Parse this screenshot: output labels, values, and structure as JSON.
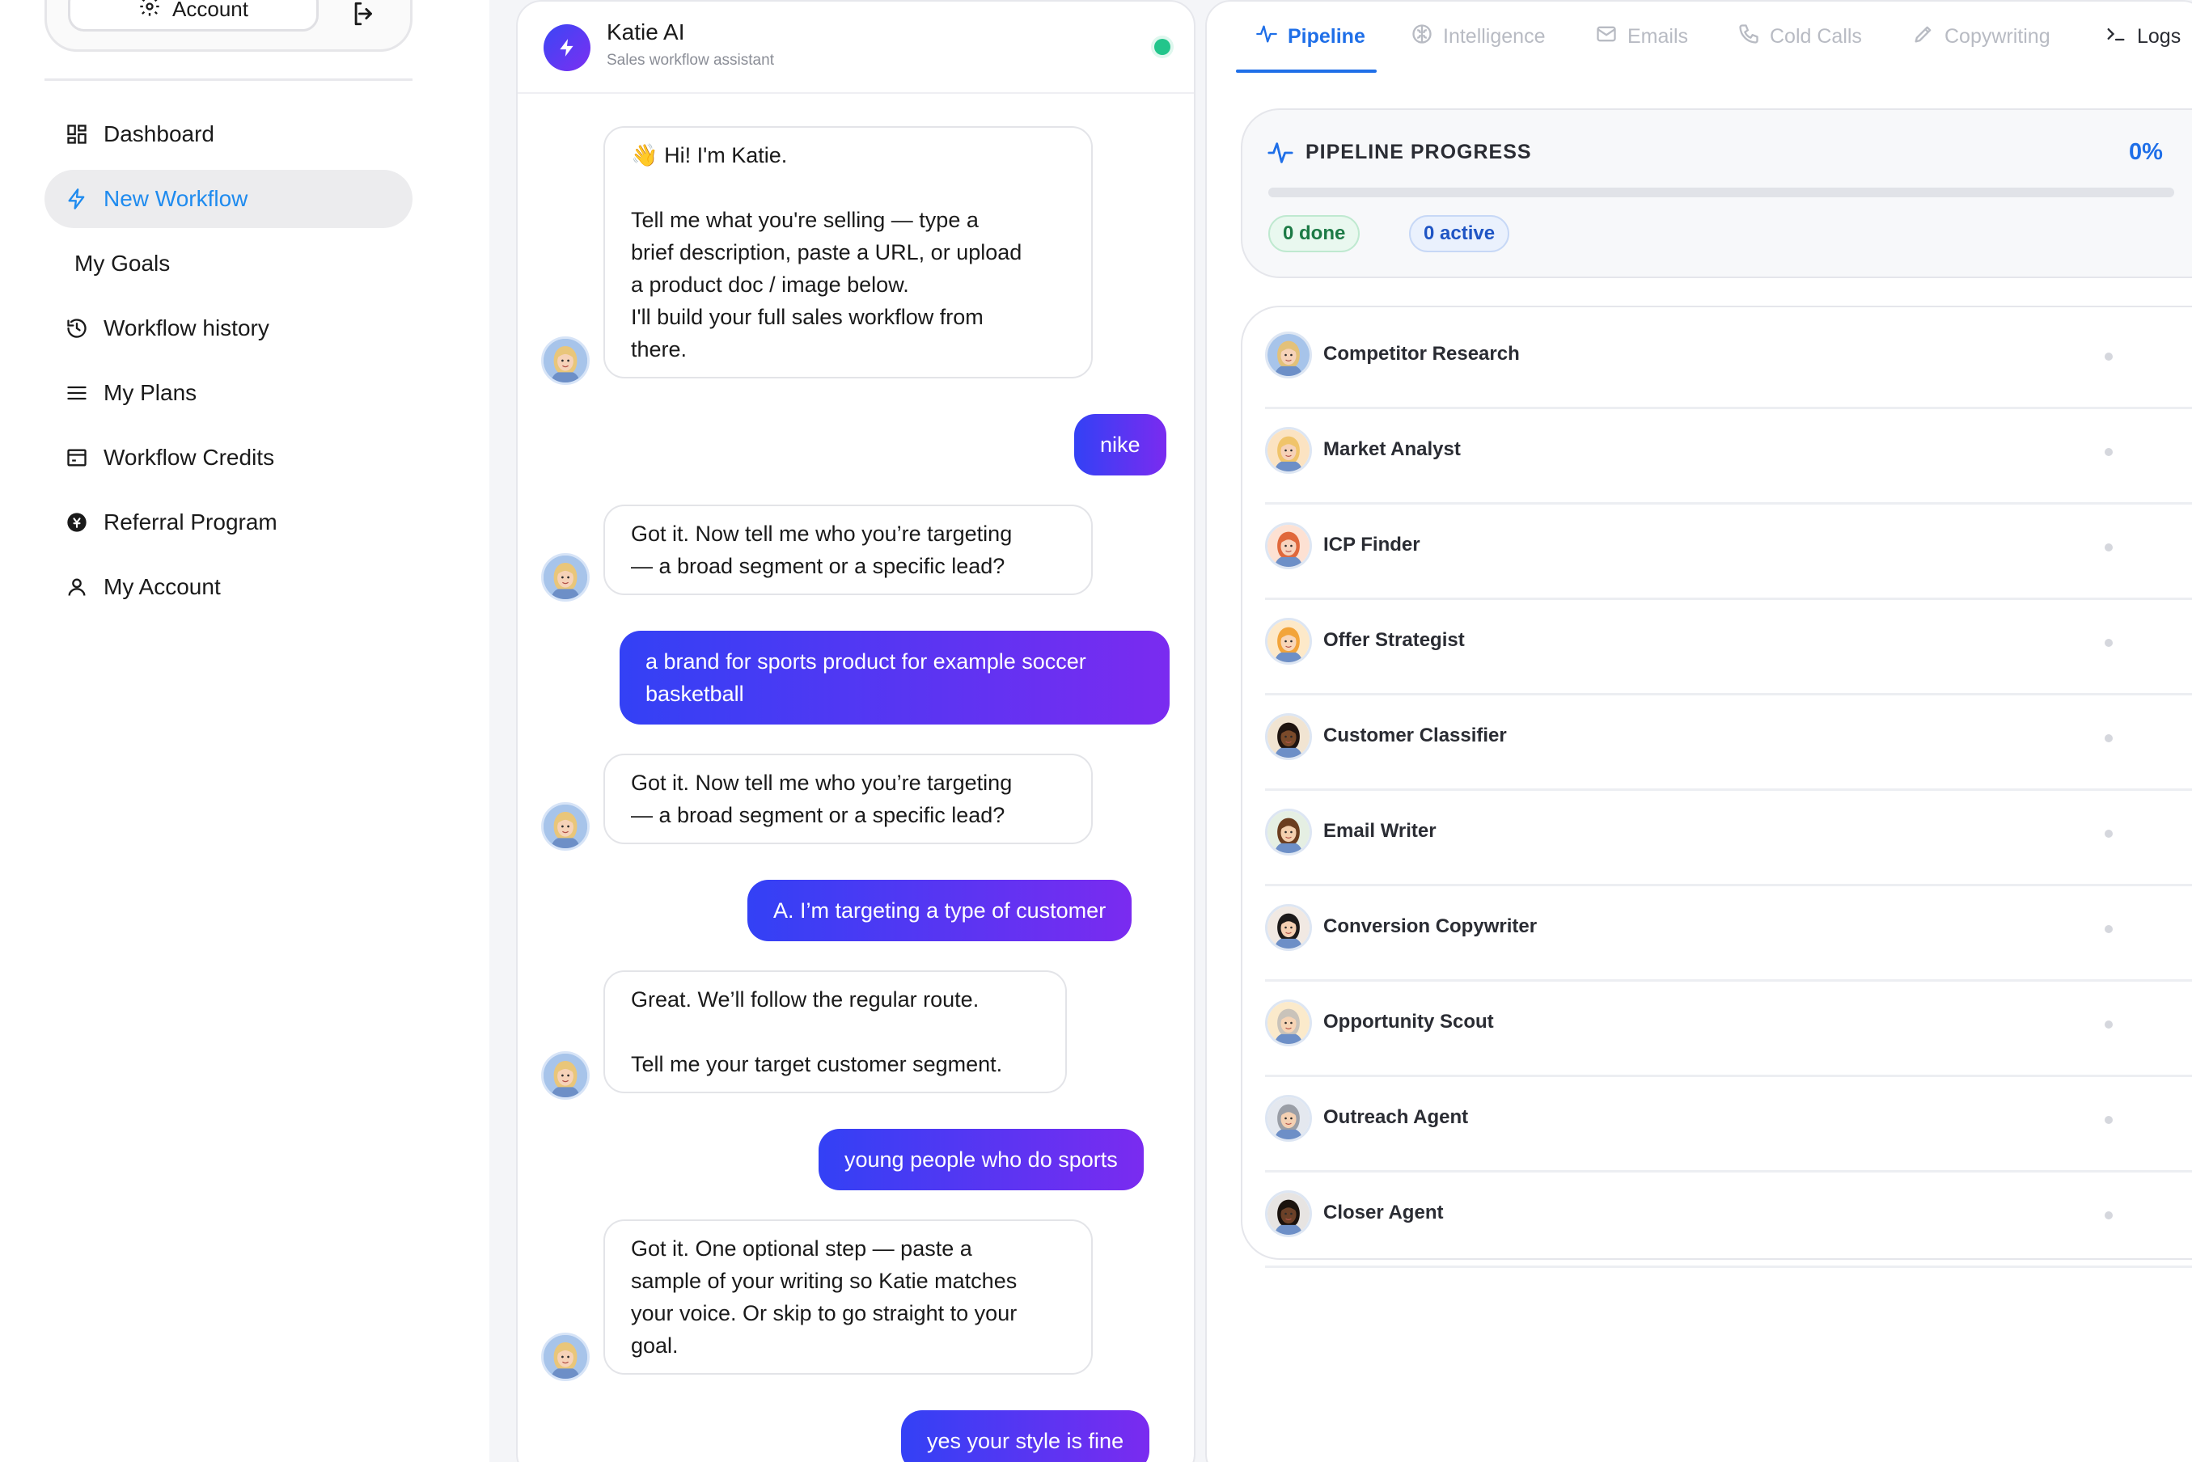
{
  "sidebar": {
    "account_label": "Account",
    "items": [
      {
        "label": "Dashboard",
        "icon": "dashboard-icon",
        "active": false
      },
      {
        "label": "New Workflow",
        "icon": "bolt-icon",
        "active": true
      },
      {
        "label": "My Goals",
        "icon": "",
        "active": false
      },
      {
        "label": "Workflow history",
        "icon": "history-icon",
        "active": false
      },
      {
        "label": "My Plans",
        "icon": "list-icon",
        "active": false
      },
      {
        "label": "Workflow Credits",
        "icon": "credits-icon",
        "active": false
      },
      {
        "label": "Referral Program",
        "icon": "coin-icon",
        "active": false
      },
      {
        "label": "My Account",
        "icon": "user-icon",
        "active": false
      }
    ]
  },
  "chat": {
    "title": "Katie AI",
    "subtitle": "Sales workflow assistant",
    "status": "online",
    "messages": [
      {
        "role": "bot",
        "text": "👋 Hi! I'm Katie.\n\nTell me what you're selling — type a\nbrief description, paste a URL, or upload\na product doc / image below.\nI'll build your full sales workflow from\nthere."
      },
      {
        "role": "user",
        "text": "nike"
      },
      {
        "role": "bot",
        "text": "Got it. Now tell me who you’re targeting\n— a broad segment or a specific lead?"
      },
      {
        "role": "user",
        "text": "a brand for sports product for example soccer\nbasketball"
      },
      {
        "role": "bot",
        "text": "Got it. Now tell me who you’re targeting\n— a broad segment or a specific lead?"
      },
      {
        "role": "user",
        "text": "A. I’m targeting a type of customer"
      },
      {
        "role": "bot",
        "text": "Great. We’ll follow the regular route.\n\nTell me your target customer segment."
      },
      {
        "role": "user",
        "text": "young people who do sports"
      },
      {
        "role": "bot",
        "text": "Got it. One optional step — paste a\nsample of your writing so Katie matches\nyour voice. Or skip to go straight to your\ngoal."
      },
      {
        "role": "user",
        "text": "yes your style is fine"
      }
    ]
  },
  "tabs": [
    {
      "label": "Pipeline",
      "icon": "pulse-icon",
      "active": true
    },
    {
      "label": "Intelligence",
      "icon": "brain-icon",
      "active": false
    },
    {
      "label": "Emails",
      "icon": "mail-icon",
      "active": false
    },
    {
      "label": "Cold Calls",
      "icon": "phone-icon",
      "active": false
    },
    {
      "label": "Copywriting",
      "icon": "pen-icon",
      "active": false
    },
    {
      "label": "Logs",
      "icon": "terminal-icon",
      "active": false
    }
  ],
  "pipeline": {
    "title": "PIPELINE PROGRESS",
    "percent_label": "0%",
    "progress": 0,
    "done_label": "0 done",
    "active_label": "0 active",
    "agents": [
      {
        "name": "Competitor Research",
        "avatar": "woman-blonde-avatar"
      },
      {
        "name": "Market Analyst",
        "avatar": "man-blond-avatar"
      },
      {
        "name": "ICP Finder",
        "avatar": "woman-redhead-avatar"
      },
      {
        "name": "Offer Strategist",
        "avatar": "woman-orange-avatar"
      },
      {
        "name": "Customer Classifier",
        "avatar": "man-dark-avatar"
      },
      {
        "name": "Email Writer",
        "avatar": "man-brown-avatar"
      },
      {
        "name": "Conversion Copywriter",
        "avatar": "woman-black-hair-avatar"
      },
      {
        "name": "Opportunity Scout",
        "avatar": "man-glasses-avatar"
      },
      {
        "name": "Outreach Agent",
        "avatar": "man-grey-avatar"
      },
      {
        "name": "Closer Agent",
        "avatar": "man-dark-suit-avatar"
      }
    ]
  },
  "colors": {
    "accent": "#1f6fe8",
    "user_bubble_start": "#3341f5",
    "user_bubble_end": "#7a2bf0",
    "online": "#22c58b"
  }
}
